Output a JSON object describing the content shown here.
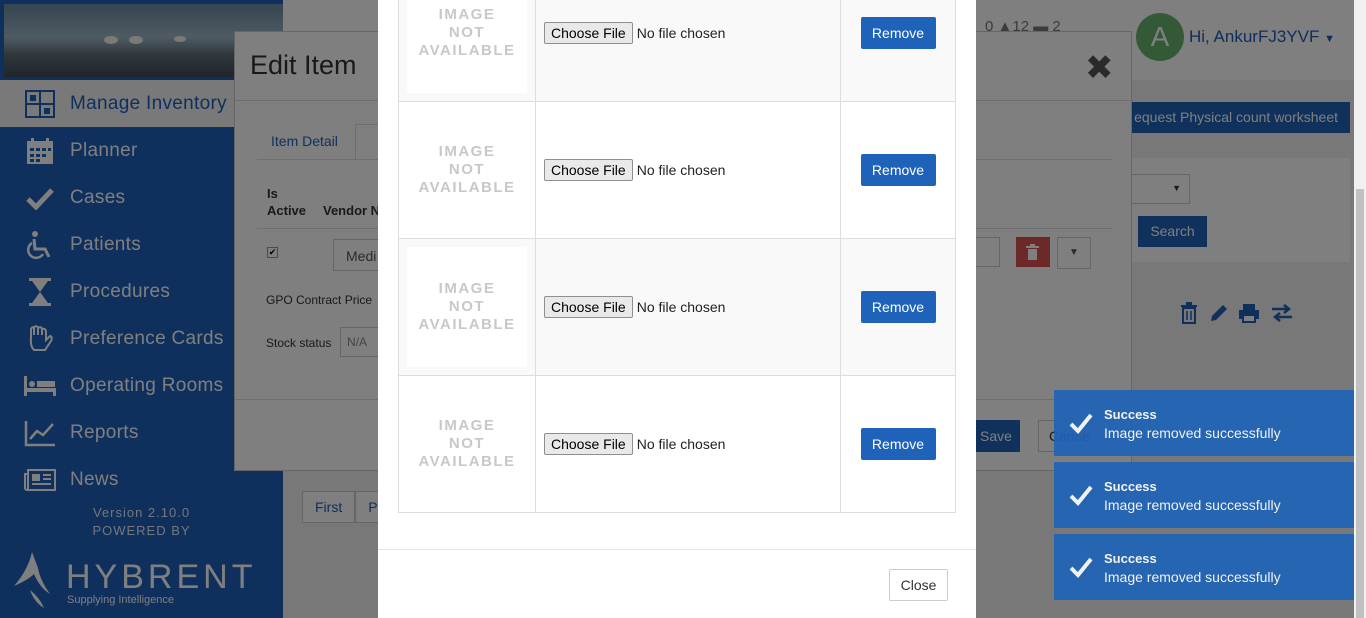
{
  "sidebar": {
    "items": [
      {
        "label": "Manage Inventory",
        "icon": "inventory-icon"
      },
      {
        "label": "Planner",
        "icon": "calendar-icon"
      },
      {
        "label": "Cases",
        "icon": "check-icon"
      },
      {
        "label": "Patients",
        "icon": "wheelchair-icon"
      },
      {
        "label": "Procedures",
        "icon": "hourglass-icon"
      },
      {
        "label": "Preference Cards",
        "icon": "glove-icon"
      },
      {
        "label": "Operating Rooms",
        "icon": "bed-icon"
      },
      {
        "label": "Reports",
        "icon": "line-chart-icon"
      },
      {
        "label": "News",
        "icon": "newspaper-icon"
      }
    ],
    "version": "Version 2.10.0",
    "powered_by": "POWERED BY",
    "brand": "HYBRENT",
    "brand_tagline": "Supplying Intelligence"
  },
  "header": {
    "counts": "0  ▲12  ▬  2",
    "avatar_letter": "A",
    "user_greeting": "Hi, AnkurFJ3YVF"
  },
  "background": {
    "request_button": "equest Physical count worksheet",
    "search_button": "Search",
    "pager_first": "First",
    "pager_prev": "Pr"
  },
  "edit_modal": {
    "title": "Edit Item",
    "tab_item_detail": "Item Detail",
    "col_is_active": "Is\nActive",
    "col_vendor": "Vendor N",
    "vendor_value": "Medi",
    "gpo_label": "GPO Contract Price",
    "stock_label": "Stock status",
    "stock_placeholder": "N/A",
    "save_label": "Save",
    "cancel_label": "Cance"
  },
  "image_modal": {
    "rows": [
      {
        "placeholder": [
          "IMAGE",
          "NOT",
          "AVAILABLE"
        ],
        "choose_label": "Choose File",
        "file_status": "No file chosen",
        "remove_label": "Remove"
      },
      {
        "placeholder": [
          "IMAGE",
          "NOT",
          "AVAILABLE"
        ],
        "choose_label": "Choose File",
        "file_status": "No file chosen",
        "remove_label": "Remove"
      },
      {
        "placeholder": [
          "IMAGE",
          "NOT",
          "AVAILABLE"
        ],
        "choose_label": "Choose File",
        "file_status": "No file chosen",
        "remove_label": "Remove"
      },
      {
        "placeholder": [
          "IMAGE",
          "NOT",
          "AVAILABLE"
        ],
        "choose_label": "Choose File",
        "file_status": "No file chosen",
        "remove_label": "Remove"
      }
    ],
    "close_label": "Close"
  },
  "toasts": [
    {
      "title": "Success",
      "message": "Image removed successfully"
    },
    {
      "title": "Success",
      "message": "Image removed successfully"
    },
    {
      "title": "Success",
      "message": "Image removed successfully"
    }
  ],
  "colors": {
    "primary": "#1e63b9",
    "sidebar": "#1f5fb8",
    "danger": "#d9534f",
    "avatar": "#67b26f"
  }
}
